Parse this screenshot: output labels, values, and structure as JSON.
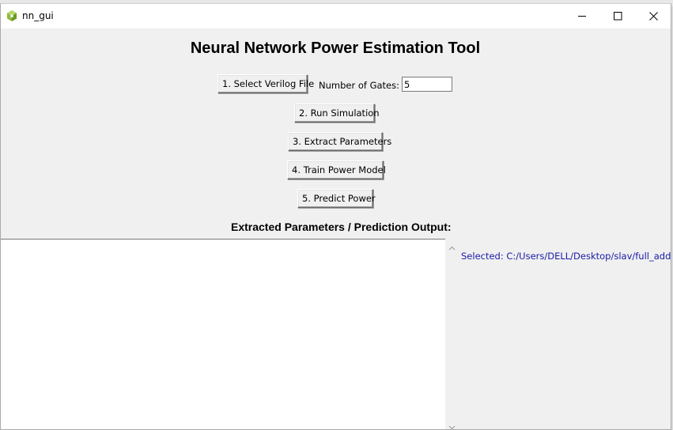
{
  "window": {
    "title": "nn_gui",
    "icon": "python-cube-icon",
    "controls": [
      "minimize",
      "maximize",
      "close"
    ]
  },
  "main": {
    "heading": "Neural Network Power Estimation Tool",
    "buttons": {
      "select_file": "1. Select Verilog File",
      "run_simulation": "2. Run Simulation",
      "extract_parameters": "3. Extract Parameters",
      "train_model": "4. Train Power Model",
      "predict_power": "5. Predict Power"
    },
    "gates": {
      "label": "Number of Gates:",
      "value": "5"
    },
    "output_label": "Extracted Parameters / Prediction Output:",
    "output_text": "",
    "status": "Selected: C:/Users/DELL/Desktop/slav/full_adder.v"
  },
  "colors": {
    "background": "#f0f0f0",
    "status_text": "#1a1aa8",
    "icon_green": "#8fbc3a"
  }
}
